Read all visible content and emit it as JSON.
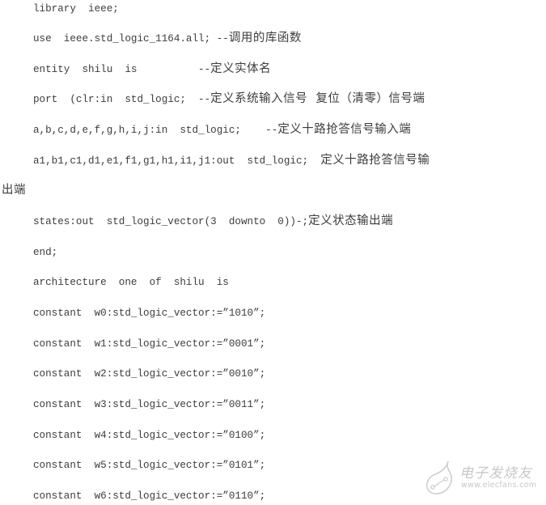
{
  "document": {
    "lines": [
      {
        "code": "library  ieee;",
        "comment": ""
      },
      {
        "code": "use  ieee.std_logic_1164.all; --",
        "comment": "调用的库函数"
      },
      {
        "code": "entity  shilu  is          --",
        "comment": "定义实体名"
      },
      {
        "code": "port  (clr:in  std_logic;  --",
        "comment": "定义系统输入信号  复位（清零）信号端"
      },
      {
        "code": "a,b,c,d,e,f,g,h,i,j:in  std_logic;    --",
        "comment": "定义十路抢答信号输入端"
      },
      {
        "code": "a1,b1,c1,d1,e1,f1,g1,h1,i1,j1:out  std_logic;  ",
        "comment": "定义十路抢答信号输"
      },
      {
        "code": "",
        "comment": "出端"
      },
      {
        "code": "states:out  std_logic_vector(3  downto  0))-;",
        "comment": "定义状态输出端"
      },
      {
        "code": "end;",
        "comment": ""
      },
      {
        "code": "architecture  one  of  shilu  is",
        "comment": ""
      },
      {
        "code": "constant  w0:std_logic_vector:=”1010”;",
        "comment": ""
      },
      {
        "code": "constant  w1:std_logic_vector:=”0001”;",
        "comment": ""
      },
      {
        "code": "constant  w2:std_logic_vector:=”0010”;",
        "comment": ""
      },
      {
        "code": "constant  w3:std_logic_vector:=”0011”;",
        "comment": ""
      },
      {
        "code": "constant  w4:std_logic_vector:=”0100”;",
        "comment": ""
      },
      {
        "code": "constant  w5:std_logic_vector:=”0101”;",
        "comment": ""
      },
      {
        "code": "constant  w6:std_logic_vector:=”0110”;",
        "comment": ""
      }
    ]
  },
  "watermark": {
    "title": "电子发烧友",
    "url": "www.elecfans.com",
    "icon": "elecfans-logo-icon"
  }
}
